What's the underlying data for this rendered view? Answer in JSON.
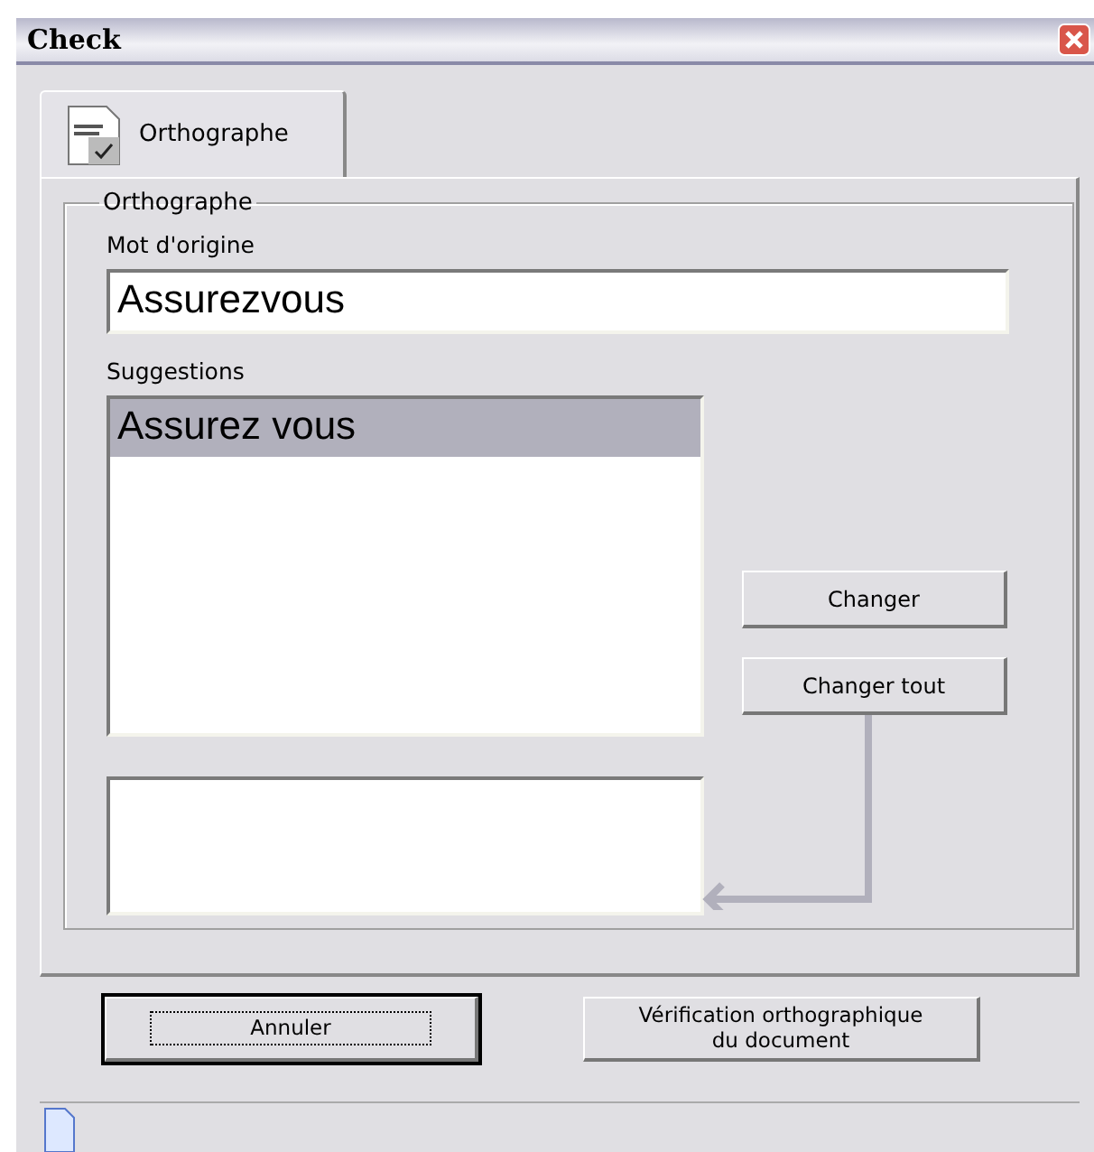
{
  "window": {
    "title": "Check"
  },
  "tabs": [
    {
      "label": "Orthographe",
      "selected": true
    }
  ],
  "group": {
    "legend": "Orthographe"
  },
  "original_word": {
    "label": "Mot d'origine",
    "value": "Assurezvous"
  },
  "suggestions": {
    "label": "Suggestions",
    "items": [
      {
        "text": "Assurez vous",
        "selected": true
      }
    ]
  },
  "action_buttons": [
    "Changer",
    "Changer tout"
  ],
  "dialog_buttons": [
    {
      "label": "Annuler",
      "focused": true
    },
    {
      "label": "Vérification orthographique du document",
      "focused": false
    }
  ]
}
